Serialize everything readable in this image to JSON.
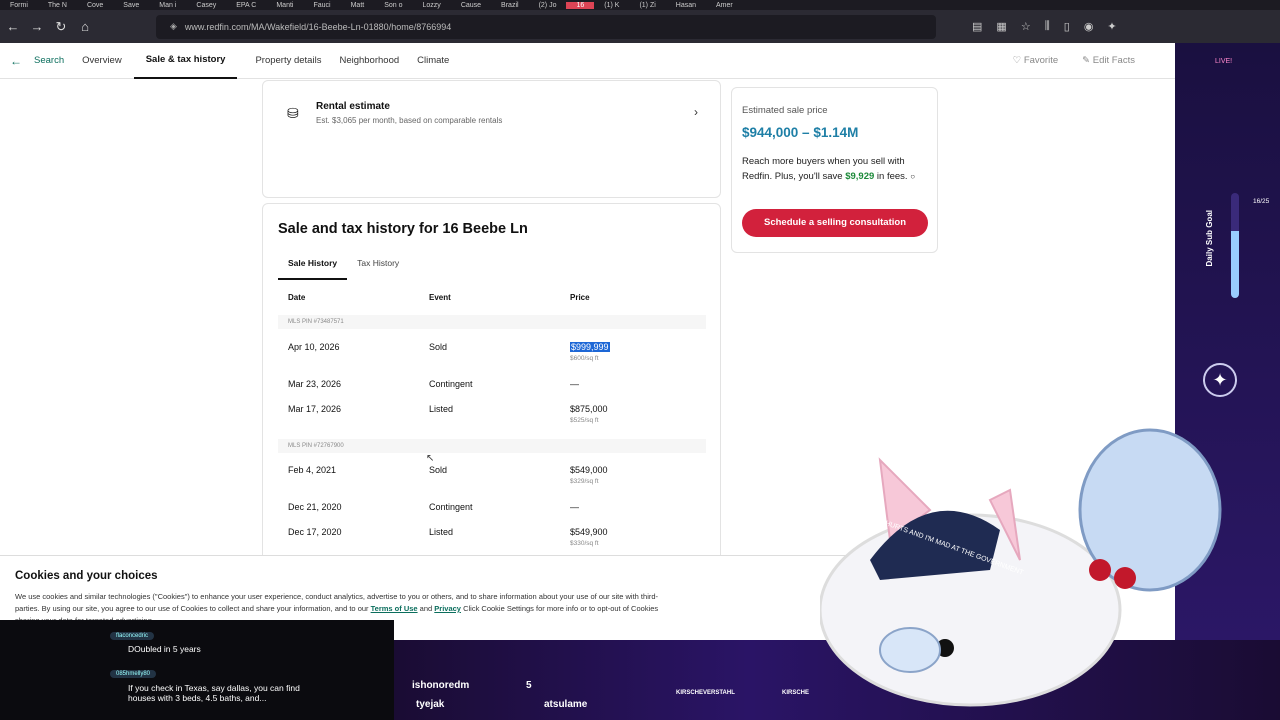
{
  "browser": {
    "tabs": [
      "Formi",
      "The N",
      "Cove",
      "Save",
      "Man i",
      "Casey",
      "EPA C",
      "Manti",
      "Fauci",
      "Matt",
      "Son o",
      "Lozzy",
      "Cause",
      "Brazil",
      "(2) Jo",
      "16",
      "(1) K",
      "(1) Zi",
      "Hasan",
      "Amer"
    ],
    "url": "www.redfin.com/MA/Wakefield/16-Beebe-Ln-01880/home/8766994"
  },
  "subnav": {
    "search": "Search",
    "items": [
      "Overview",
      "Sale & tax history",
      "Property details",
      "Neighborhood",
      "Climate"
    ],
    "favorite": "Favorite",
    "edit_facts": "Edit Facts"
  },
  "rental": {
    "title": "Rental estimate",
    "subtitle": "Est. $3,065 per month, based on comparable rentals"
  },
  "history": {
    "title": "Sale and tax history for 16 Beebe Ln",
    "tabs": [
      "Sale History",
      "Tax History"
    ],
    "columns": [
      "Date",
      "Event",
      "Price"
    ],
    "groups": [
      {
        "mls": "MLS PIN #73487571",
        "rows": [
          {
            "date": "Apr 10, 2026",
            "event": "Sold",
            "price": "$999,999",
            "per_sqft": "$600/sq ft"
          },
          {
            "date": "Mar 23, 2026",
            "event": "Contingent",
            "price": "—",
            "per_sqft": ""
          },
          {
            "date": "Mar 17, 2026",
            "event": "Listed",
            "price": "$875,000",
            "per_sqft": "$525/sq ft"
          }
        ]
      },
      {
        "mls": "MLS PIN #72767900",
        "rows": [
          {
            "date": "Feb 4, 2021",
            "event": "Sold",
            "price": "$549,000",
            "per_sqft": "$329/sq ft"
          },
          {
            "date": "Dec 21, 2020",
            "event": "Contingent",
            "price": "—",
            "per_sqft": ""
          },
          {
            "date": "Dec 17, 2020",
            "event": "Listed",
            "price": "$549,900",
            "per_sqft": "$330/sq ft"
          }
        ]
      }
    ]
  },
  "sale_card": {
    "label": "Estimated sale price",
    "price": "$944,000 – $1.14M",
    "desc_a": "Reach more buyers when you sell with Redfin. Plus, you'll save ",
    "desc_save": "$9,929",
    "desc_b": " in fees.",
    "button": "Schedule a selling consultation"
  },
  "cookies": {
    "title": "Cookies and your choices",
    "text_a": "We use cookies and similar technologies (\"Cookies\") to enhance your user experience, conduct analytics, advertise to you or others, and to share information about your use of our site with third-parties. By using our site, you agree to our use of Cookies to collect and share your information, and to our ",
    "terms": "Terms of Use",
    "and": " and ",
    "privacy": "Privacy",
    "text_b": " Click Cookie Settings for more info or to opt-out of Cookies sharing your data for targeted advertising."
  },
  "stream": {
    "chat": [
      {
        "user": "flaconcedric",
        "msg": "DOubled in 5 years"
      },
      {
        "user": "085hmelly80",
        "msg": "If you check in Texas, say dallas, you can find houses with 3 beds, 4.5 baths, and..."
      }
    ],
    "names": [
      "ishonoredm",
      "5",
      "tyejak",
      "atsulame"
    ],
    "handles": [
      "KIRSCHEVERSTAHL",
      "KIRSCHE"
    ],
    "goal_label": "Daily Sub Goal",
    "goal_count": "16/25",
    "live": "LIVE!",
    "hat_text": "MY TUMMY HURTS AND I'M MAD AT THE GOVERNMENT"
  }
}
